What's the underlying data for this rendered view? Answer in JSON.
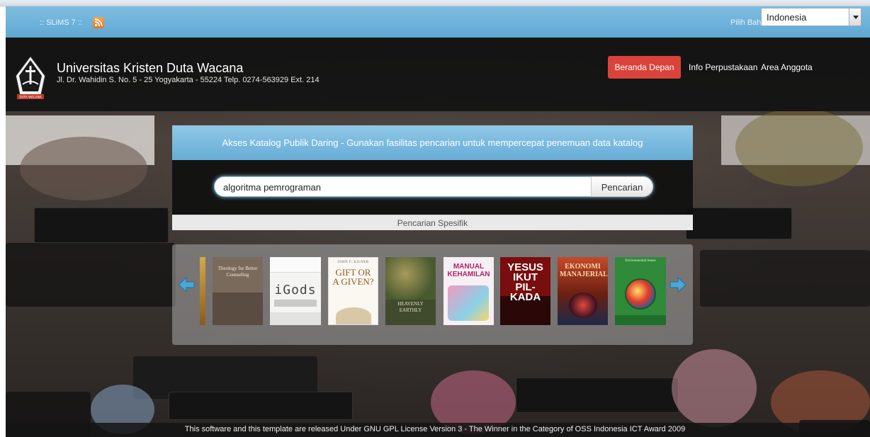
{
  "topbar": {
    "app_label": ":: SLiMS 7 ::",
    "rss_icon": "rss-feed-icon",
    "language_label": "Pilih Bahasa",
    "language_selected": "Indonesia"
  },
  "header": {
    "institution_name": "Universitas Kristen Duta Wacana",
    "address": "Jl. Dr. Wahidin S. No. 5 - 25 Yogyakarta - 55224 Telp. 0274-563929 Ext. 214",
    "logo_caption": "DUTA WACANA"
  },
  "nav": {
    "home": "Beranda Depan",
    "library_info": "Info Perpustakaan",
    "member_area": "Area Anggota"
  },
  "search": {
    "heading": "Akses Katalog Publik Daring - Gunakan fasilitas pencarian untuk mempercepat penemuan data katalog",
    "query": "algoritma pemrograman",
    "button": "Pencarian",
    "advanced": "Pencarian Spesifik"
  },
  "books": [
    {
      "id": "b1",
      "title": "Theology for Better Counseling"
    },
    {
      "id": "b2",
      "title": "iGods"
    },
    {
      "id": "b3",
      "author": "JOHN F. KILNER",
      "title": "GIFT OR A GIVEN?"
    },
    {
      "id": "b4",
      "title": "HEAVENLY EARTHLY"
    },
    {
      "id": "b5",
      "title": "MANUAL KEHAMILAN"
    },
    {
      "id": "b6",
      "title": "YESUS IKUT PIL-KADA"
    },
    {
      "id": "b7",
      "title": "EKONOMI MANAJERIAL"
    },
    {
      "id": "b8",
      "title": "Environmental Issues"
    }
  ],
  "footer": {
    "text": "This software and this template are released Under GNU GPL License Version 3 - The Winner in the Category of OSS Indonesia ICT Award 2009"
  },
  "colors": {
    "topbar_blue": "#6fb3db",
    "home_button_red": "#d9433a",
    "header_dark": "#121212"
  }
}
